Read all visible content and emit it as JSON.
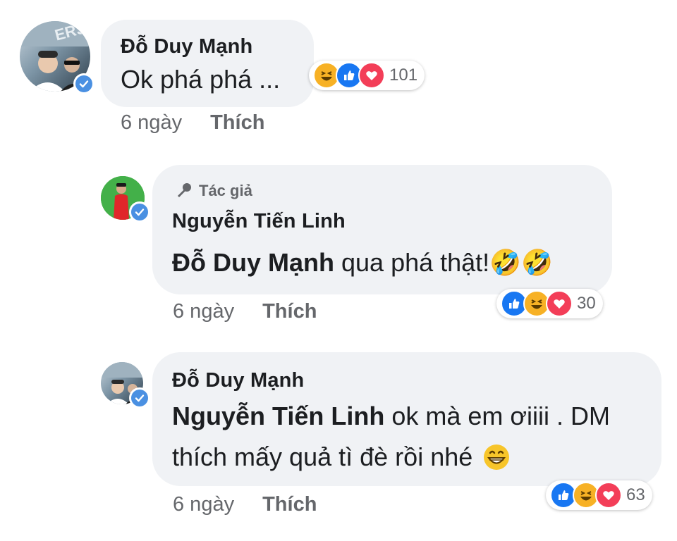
{
  "comments": [
    {
      "author": "Đỗ Duy Mạnh",
      "text": "Ok phá phá ...",
      "time": "6 ngày",
      "like": "Thích",
      "reaction_count": "101",
      "reactions": [
        "haha-icon",
        "like-icon",
        "love-icon"
      ]
    },
    {
      "author_tag": "Tác giả",
      "author": "Nguyễn Tiến Linh",
      "mention": "Đỗ Duy Mạnh",
      "text": " qua phá thật!",
      "emoji": "🤣🤣",
      "time": "6 ngày",
      "like": "Thích",
      "reaction_count": "30",
      "reactions": [
        "like-icon",
        "haha-icon",
        "love-icon"
      ]
    },
    {
      "author": "Đỗ Duy Mạnh",
      "mention": "Nguyễn Tiến Linh",
      "text_line1": " ok mà em ơiiii . DM",
      "text_line2": "thích mấy quả tì đè rồi nhé",
      "time": "6 ngày",
      "like": "Thích",
      "reaction_count": "63",
      "reactions": [
        "like-icon",
        "haha-icon",
        "love-icon"
      ]
    }
  ],
  "colors": {
    "bubble": "#f0f2f5",
    "meta_text": "#65676b",
    "like_blue": "#1877f2",
    "love_red": "#f33e58",
    "haha_yellow": "#f7b125",
    "verified_blue": "#4a90e2"
  }
}
